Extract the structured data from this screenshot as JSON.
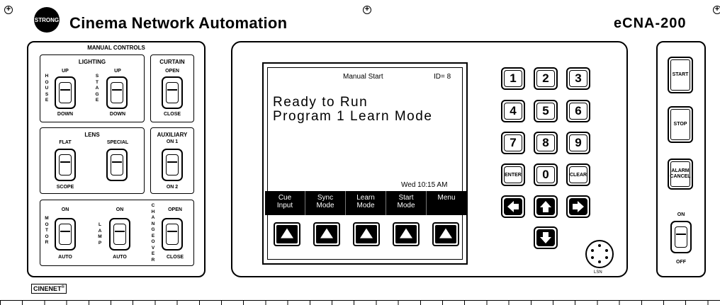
{
  "header": {
    "logo_text": "STRONG",
    "title": "Cinema Network Automation",
    "model": "eCNA-200"
  },
  "manual_controls": {
    "title": "MANUAL CONTROLS",
    "lighting": {
      "title": "LIGHTING",
      "house_label": "HOUSE",
      "stage_label": "STAGE",
      "house_up": "UP",
      "house_down": "DOWN",
      "stage_up": "UP",
      "stage_down": "DOWN"
    },
    "curtain": {
      "title": "CURTAIN",
      "open": "OPEN",
      "close": "CLOSE"
    },
    "lens": {
      "title": "LENS",
      "flat": "FLAT",
      "special": "SPECIAL",
      "scope": "SCOPE"
    },
    "auxiliary": {
      "title": "AUXILIARY",
      "on1": "ON 1",
      "on2": "ON 2"
    },
    "motor": {
      "label": "MOTOR",
      "on": "ON",
      "auto": "AUTO"
    },
    "lamp": {
      "label": "LAMP",
      "on": "ON",
      "auto": "AUTO"
    },
    "changeover": {
      "label": "CHANGEOVER",
      "open": "OPEN",
      "close": "CLOSE"
    }
  },
  "display": {
    "header": "Manual Start",
    "id": "ID= 8",
    "line1": "Ready to Run",
    "line2": "Program 1 Learn Mode",
    "datetime": "Wed 10:15 AM",
    "softkeys": [
      {
        "line1": "Cue",
        "line2": "Input"
      },
      {
        "line1": "Sync",
        "line2": "Mode"
      },
      {
        "line1": "Learn",
        "line2": "Mode"
      },
      {
        "line1": "Start",
        "line2": "Mode"
      },
      {
        "line1": "Menu",
        "line2": ""
      }
    ]
  },
  "keypad": {
    "k1": "1",
    "k2": "2",
    "k3": "3",
    "k4": "4",
    "k5": "5",
    "k6": "6",
    "k7": "7",
    "k8": "8",
    "k9": "9",
    "enter": "ENTER",
    "k0": "0",
    "clear": "CLEAR",
    "port_label": "LSN"
  },
  "control": {
    "start": "START",
    "stop": "STOP",
    "alarm_cancel": "ALARM CANCEL",
    "power_on": "ON",
    "power_off": "OFF"
  },
  "footer": {
    "brand": "CINENET",
    "brand_mark": "®"
  }
}
